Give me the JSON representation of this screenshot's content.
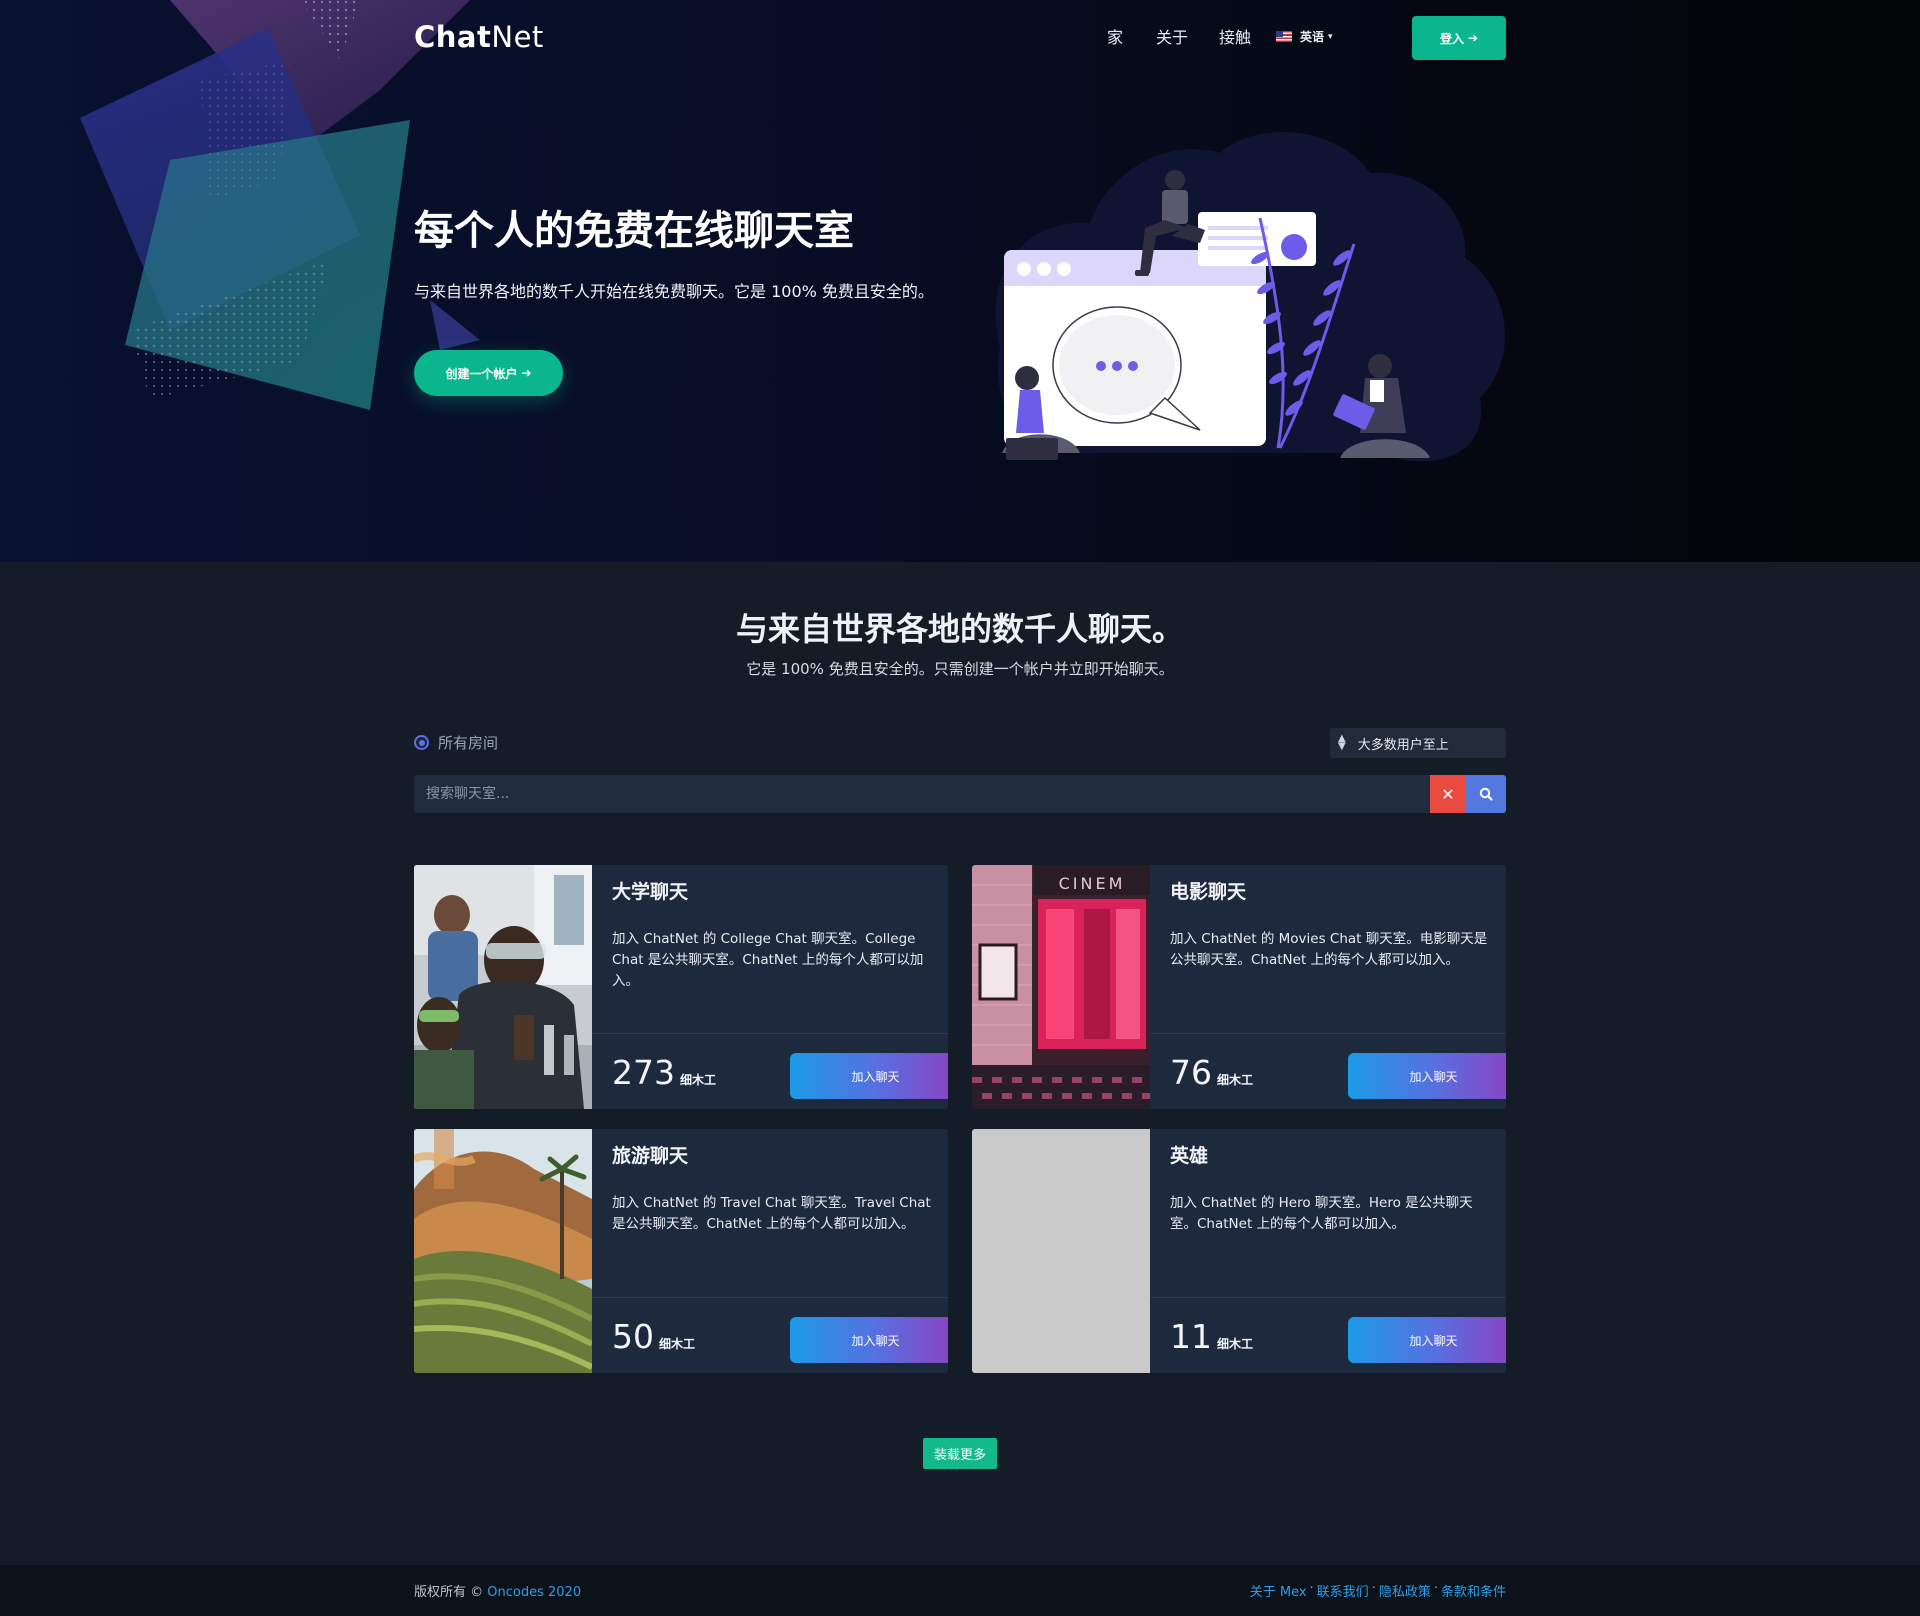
{
  "brand": {
    "name_bold": "Chat",
    "name_light": "Net"
  },
  "nav": {
    "home": "家",
    "about": "关于",
    "contact": "接触",
    "language": "英语",
    "login": "登入"
  },
  "hero": {
    "title": "每个人的免费在线聊天室",
    "subtitle": "与来自世界各地的数千人开始在线免费聊天。它是 100% 免费且安全的。",
    "cta": "创建一个帐户"
  },
  "rooms_section": {
    "title": "与来自世界各地的数千人聊天。",
    "subtitle": "它是 100% 免费且安全的。只需创建一个帐户并立即开始聊天。",
    "filter_label": "所有房间",
    "sort_label": "大多数用户至上",
    "search_placeholder": "搜索聊天室...",
    "load_more": "装载更多"
  },
  "rooms": [
    {
      "title": "大学聊天",
      "description": "加入 ChatNet 的 College Chat 聊天室。College Chat 是公共聊天室。ChatNet 上的每个人都可以加入。",
      "count": "273",
      "unit": "细木工",
      "join": "加入聊天"
    },
    {
      "title": "电影聊天",
      "description": "加入 ChatNet 的 Movies Chat 聊天室。电影聊天是公共聊天室。ChatNet 上的每个人都可以加入。",
      "count": "76",
      "unit": "细木工",
      "join": "加入聊天"
    },
    {
      "title": "旅游聊天",
      "description": "加入 ChatNet 的 Travel Chat 聊天室。Travel Chat 是公共聊天室。ChatNet 上的每个人都可以加入。",
      "count": "50",
      "unit": "细木工",
      "join": "加入聊天"
    },
    {
      "title": "英雄",
      "description": "加入 ChatNet 的 Hero 聊天室。Hero 是公共聊天室。ChatNet 上的每个人都可以加入。",
      "count": "11",
      "unit": "细木工",
      "join": "加入聊天"
    }
  ],
  "footer": {
    "copyright": "版权所有 ©",
    "company": "Oncodes 2020",
    "links": [
      "关于 Mex",
      "联系我们",
      "隐私政策",
      "条款和条件"
    ]
  },
  "colors": {
    "accent": "#0bb58e",
    "danger": "#e84a3f",
    "primary": "#5379e0",
    "link": "#2f9ee8"
  }
}
